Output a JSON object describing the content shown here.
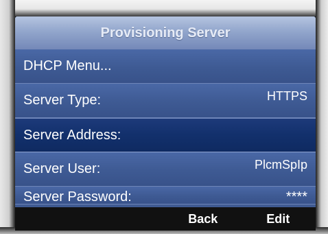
{
  "title": "Provisioning Server",
  "menu": {
    "items": [
      {
        "label": "DHCP Menu...",
        "value": ""
      },
      {
        "label": "Server Type:",
        "value": "HTTPS"
      },
      {
        "label": "Server Address:",
        "value": ""
      },
      {
        "label": "Server User:",
        "value": "PlcmSpIp"
      },
      {
        "label": "Server Password:",
        "value": "****"
      }
    ],
    "selected_index": 2
  },
  "softkeys": [
    "",
    "",
    "Back",
    "Edit"
  ],
  "colors": {
    "screen_bg": "#3f5a91",
    "selected_bg": "#12306c",
    "softkey_bar": "#111111",
    "text": "#ffffff"
  }
}
